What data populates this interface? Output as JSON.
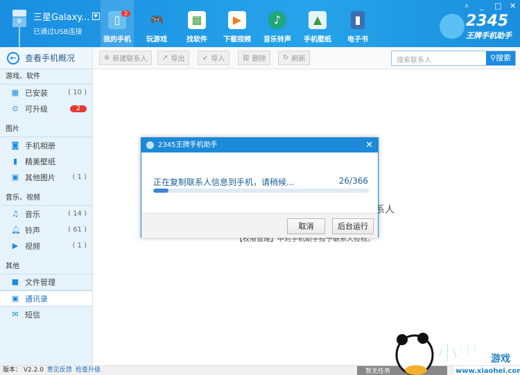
{
  "device": {
    "name": "三星Galaxy...",
    "status": "已通过USB连接"
  },
  "nav": [
    {
      "label": "我的手机",
      "badge": "2",
      "icon": "phone-icon"
    },
    {
      "label": "玩游戏",
      "icon": "gamepad-icon"
    },
    {
      "label": "找软件",
      "icon": "app-store-icon"
    },
    {
      "label": "下载视频",
      "icon": "video-icon"
    },
    {
      "label": "音乐铃声",
      "icon": "music-icon"
    },
    {
      "label": "手机壁纸",
      "icon": "wallpaper-icon"
    },
    {
      "label": "电子书",
      "icon": "book-icon"
    }
  ],
  "brand": {
    "number": "2345",
    "text": "王牌手机助手"
  },
  "sidebar": {
    "back": "查看手机概况",
    "groups": [
      {
        "title": "游戏、软件",
        "items": [
          {
            "label": "已安装",
            "count": "( 10 )"
          },
          {
            "label": "可升级",
            "badge": "2"
          }
        ]
      },
      {
        "title": "图片",
        "items": [
          {
            "label": "手机相册"
          },
          {
            "label": "精美壁纸"
          },
          {
            "label": "其他图片",
            "count": "( 1 )"
          }
        ]
      },
      {
        "title": "音乐、视频",
        "items": [
          {
            "label": "音乐",
            "count": "( 14 )"
          },
          {
            "label": "铃声",
            "count": "( 61 )"
          },
          {
            "label": "视频",
            "count": "( 1 )"
          }
        ]
      },
      {
        "title": "其他",
        "items": [
          {
            "label": "文件管理"
          },
          {
            "label": "通讯录"
          },
          {
            "label": "短信"
          }
        ]
      }
    ]
  },
  "toolbar": {
    "new": "新建联系人",
    "export": "导出",
    "import": "导入",
    "delete": "删除",
    "refresh": "刷新",
    "search_placeholder": "搜索联系人",
    "search_button": "搜索"
  },
  "background": {
    "line1": "系人",
    "line2": "【权限管理】中对手机助手授予联系人授权。"
  },
  "dialog": {
    "title": "2345王牌手机助手",
    "message": "正在复制联系人信息到手机，请稍候...",
    "done": 26,
    "total": 366,
    "counter": "26/366",
    "cancel": "取消",
    "background_run": "后台运行"
  },
  "status": {
    "version": "版本： V2.2.0",
    "feedback": "意见反馈",
    "upgrade": "检查升级",
    "task": "暂无任务"
  },
  "watermark": {
    "text": "小黑游戏",
    "url": "www.xiaohei.com"
  },
  "colors": {
    "accent": "#1a8be0",
    "badge": "#e53935"
  }
}
